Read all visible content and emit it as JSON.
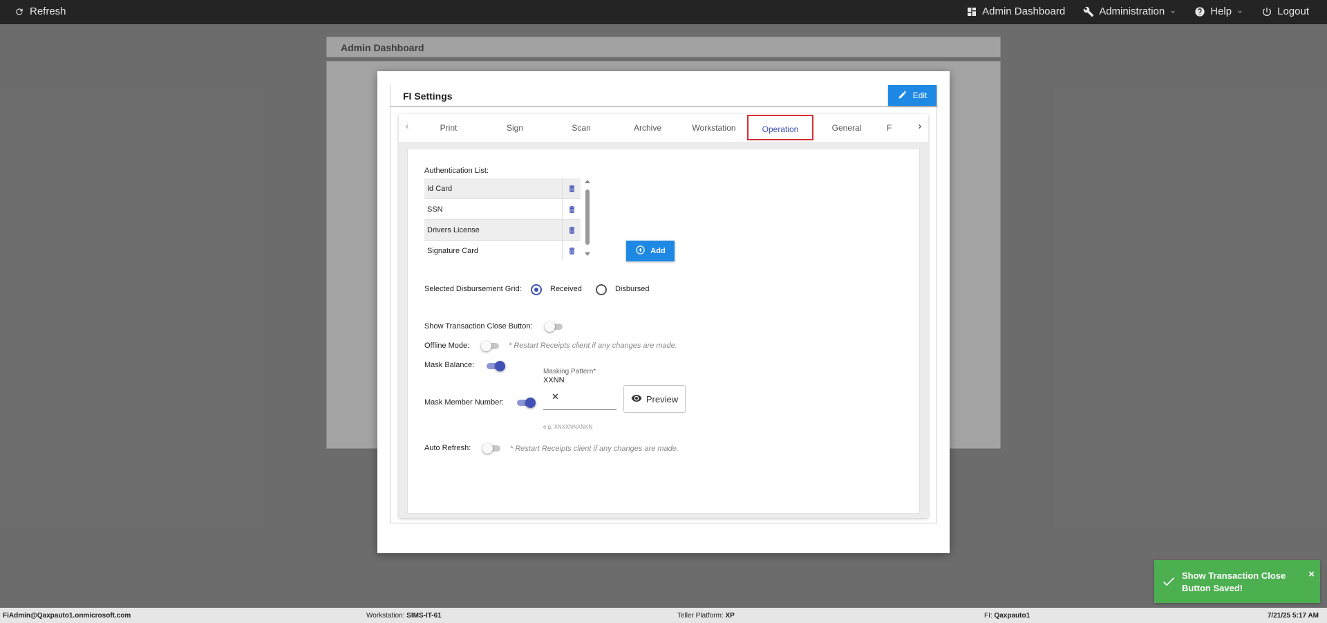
{
  "topnav": {
    "refresh_label": "Refresh",
    "admin_dashboard_label": "Admin Dashboard",
    "administration_label": "Administration",
    "help_label": "Help",
    "logout_label": "Logout"
  },
  "background": {
    "card_title": "Admin Dashboard"
  },
  "modal": {
    "title": "FI Settings",
    "edit_label": "Edit",
    "tabs": [
      {
        "label": "Print"
      },
      {
        "label": "Sign"
      },
      {
        "label": "Scan"
      },
      {
        "label": "Archive"
      },
      {
        "label": "Workstation"
      },
      {
        "label": "Operation",
        "active": true
      },
      {
        "label": "General"
      },
      {
        "label": "F"
      }
    ],
    "operation": {
      "auth_list_label": "Authentication List:",
      "auth_items": [
        "Id Card",
        "SSN",
        "Drivers License",
        "Signature Card"
      ],
      "add_label": "Add",
      "disbursement_label": "Selected Disbursement Grid:",
      "received_label": "Received",
      "disbursed_label": "Disbursed",
      "disbursement_selected": "Received",
      "show_close_label": "Show Transaction Close Button:",
      "show_close_on": false,
      "offline_label": "Offline Mode:",
      "offline_on": false,
      "offline_note": "* Restart Receipts client if any changes are made.",
      "mask_balance_label": "Mask Balance:",
      "mask_balance_on": true,
      "mask_member_label": "Mask Member Number:",
      "mask_member_on": true,
      "masking_pattern_label": "Masking Pattern*",
      "masking_pattern_value": "XXNN",
      "masking_hint": "e.g. XNXXNNXNXN",
      "preview_label": "Preview",
      "auto_refresh_label": "Auto Refresh:",
      "auto_refresh_on": false,
      "auto_refresh_note": "* Restart Receipts client if any changes are made."
    }
  },
  "toast": {
    "message": "Show Transaction Close Button Saved!",
    "color": "#4caf50"
  },
  "statusbar": {
    "user": "FiAdmin@Qaxpauto1.onmicrosoft.com",
    "workstation_label": "Workstation:",
    "workstation_value": "SIMS-IT-61",
    "platform_label": "Teller Platform:",
    "platform_value": "XP",
    "fi_label": "FI:",
    "fi_value": "Qaxpauto1",
    "datetime": "7/21/25 5:17 AM"
  },
  "colors": {
    "accent": "#1e88e5",
    "primary": "#3f51b5",
    "active_tab_border": "#d32f2f",
    "topnav_bg": "#242424"
  }
}
